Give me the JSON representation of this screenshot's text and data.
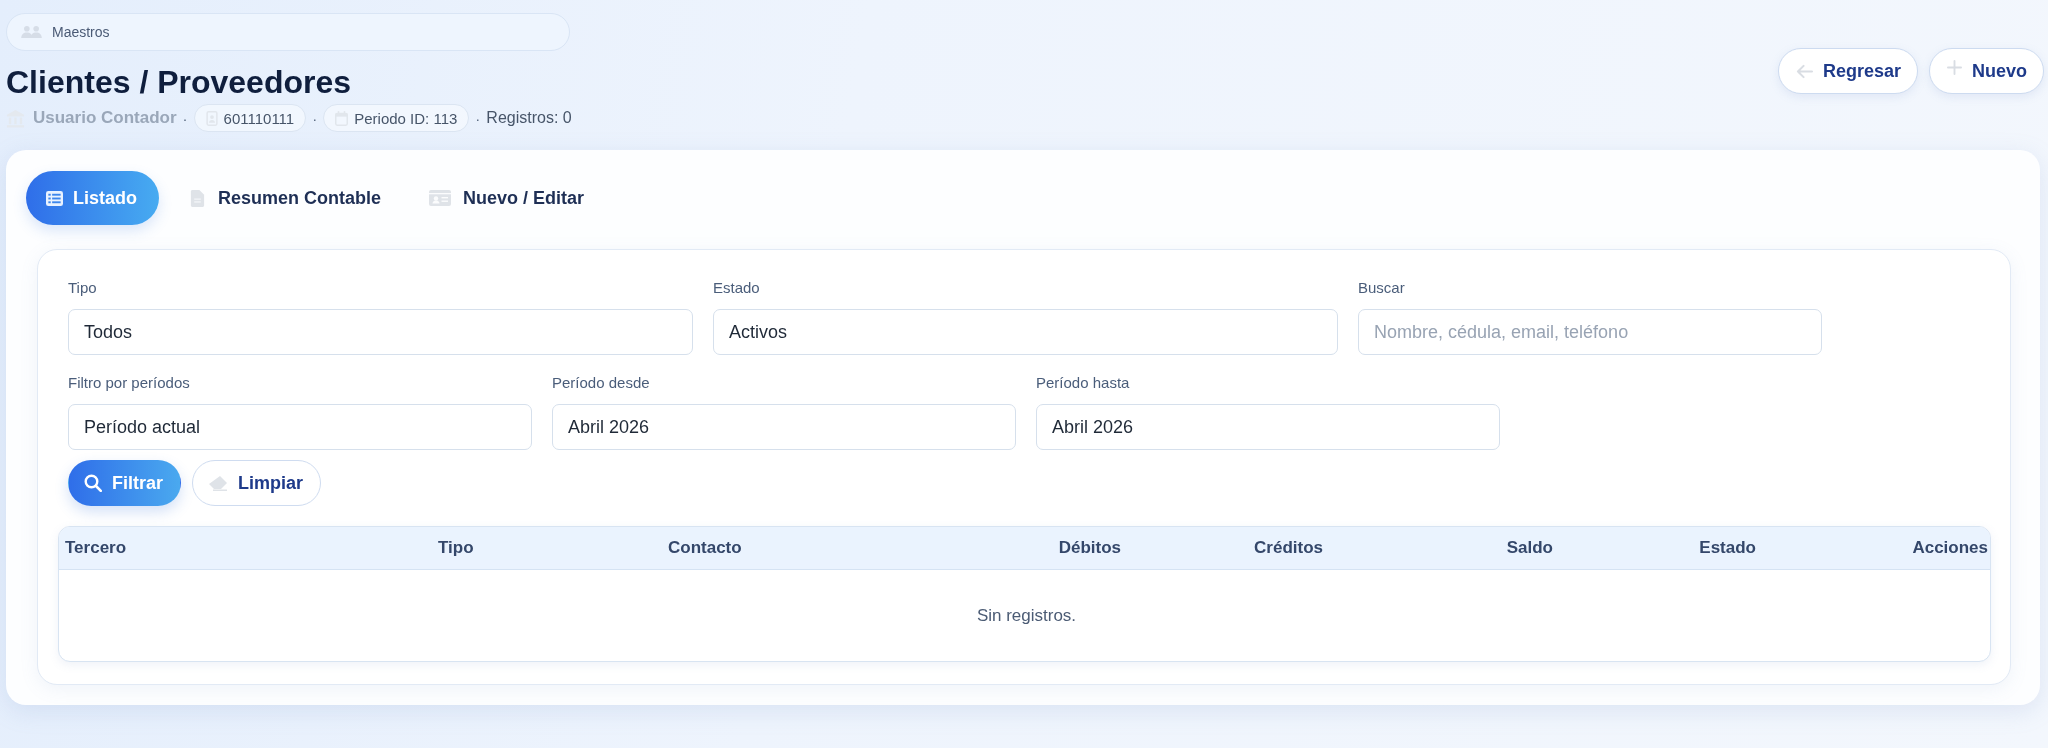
{
  "breadcrumb": {
    "label": "Maestros"
  },
  "header": {
    "title": "Clientes / Proveedores",
    "meta": [
      {
        "kind": "user",
        "text": "Usuario Contador"
      },
      {
        "kind": "separator",
        "text": "·"
      },
      {
        "kind": "document",
        "text": "601110111"
      },
      {
        "kind": "separator",
        "text": "·"
      },
      {
        "kind": "period",
        "text": "Periodo ID: 113"
      },
      {
        "kind": "separator",
        "text": "·"
      },
      {
        "kind": "plain",
        "text": "Registros: 0"
      }
    ]
  },
  "actions": [
    {
      "kind": "back",
      "label": "Regresar"
    },
    {
      "kind": "add",
      "label": "Nuevo"
    }
  ],
  "tabs": [
    {
      "kind": "list",
      "label": "Listado",
      "selected": true
    },
    {
      "kind": "summary",
      "label": "Resumen Contable",
      "selected": false
    },
    {
      "kind": "edit",
      "label": "Nuevo / Editar",
      "selected": false
    }
  ],
  "filters": {
    "rows": [
      [
        {
          "label": "Tipo",
          "value": "Todos"
        },
        {
          "label": "Estado",
          "value": "Activos"
        },
        {
          "label": "Buscar",
          "placeholder": "Nombre, cédula, email, teléfono"
        }
      ],
      [
        {
          "label": "Filtro por períodos",
          "value": "Período actual"
        },
        {
          "label": "Período desde",
          "value": "Abril 2026"
        },
        {
          "label": "Período hasta",
          "value": "Abril 2026"
        }
      ]
    ],
    "buttons": [
      {
        "kind": "filter",
        "label": "Filtrar"
      },
      {
        "kind": "clear",
        "label": "Limpiar"
      }
    ]
  },
  "table": {
    "columns": [
      "Tercero",
      "Tipo",
      "Contacto",
      "Débitos",
      "Créditos",
      "Saldo",
      "Estado",
      "Acciones"
    ],
    "empty_message": "Sin registros."
  }
}
